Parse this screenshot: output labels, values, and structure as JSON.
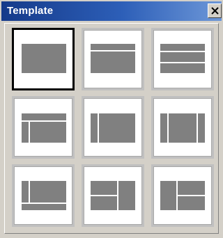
{
  "window": {
    "title": "Template",
    "title_bar_color": "#2352a8",
    "close_icon": "close-icon"
  },
  "templates": [
    {
      "id": "single",
      "selected": true
    },
    {
      "id": "header-top"
    },
    {
      "id": "three-rows"
    },
    {
      "id": "header-left-column"
    },
    {
      "id": "left-column"
    },
    {
      "id": "two-side-columns"
    },
    {
      "id": "left-column-footer"
    },
    {
      "id": "header-right-column"
    },
    {
      "id": "left-column-right-split"
    }
  ],
  "colors": {
    "placeholder_fill": "#808080",
    "tile_background": "#ffffff",
    "selected_border": "#000000",
    "tile_border": "#c0c0c0",
    "window_face": "#d4d0c8"
  }
}
